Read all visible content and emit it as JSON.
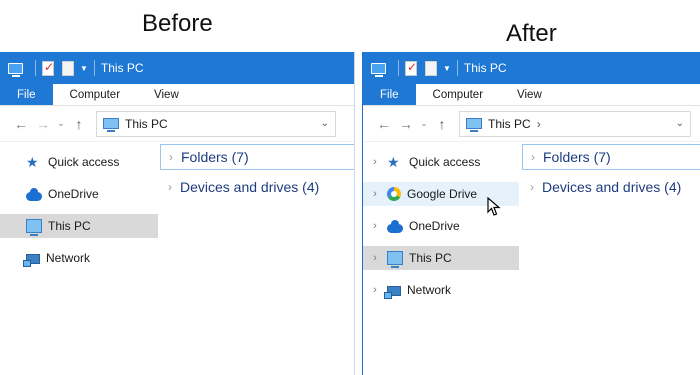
{
  "captions": {
    "before": "Before",
    "after": "After"
  },
  "before": {
    "title": "This PC",
    "ribbon": [
      "File",
      "Computer",
      "View"
    ],
    "address": "This PC",
    "nav": [
      {
        "label": "Quick access",
        "icon": "star-icon"
      },
      {
        "label": "OneDrive",
        "icon": "cloud-icon"
      },
      {
        "label": "This PC",
        "icon": "monitor-icon",
        "selected": true
      },
      {
        "label": "Network",
        "icon": "network-icon"
      }
    ],
    "groups": [
      {
        "label": "Folders (7)"
      },
      {
        "label": "Devices and drives (4)"
      }
    ]
  },
  "after": {
    "title": "This PC",
    "ribbon": [
      "File",
      "Computer",
      "View"
    ],
    "address": "This PC",
    "address_chevron": "›",
    "nav": [
      {
        "label": "Quick access",
        "icon": "star-icon"
      },
      {
        "label": "Google Drive",
        "icon": "google-drive-icon",
        "hover": true
      },
      {
        "label": "OneDrive",
        "icon": "cloud-icon"
      },
      {
        "label": "This PC",
        "icon": "monitor-icon",
        "selected": true
      },
      {
        "label": "Network",
        "icon": "network-icon"
      }
    ],
    "groups": [
      {
        "label": "Folders (7)"
      },
      {
        "label": "Devices and drives (4)"
      }
    ]
  },
  "colors": {
    "accent": "#1e78d4",
    "selected": "#d9d9d9",
    "hover": "#e5f1fb",
    "group_text": "#1e3c80"
  }
}
